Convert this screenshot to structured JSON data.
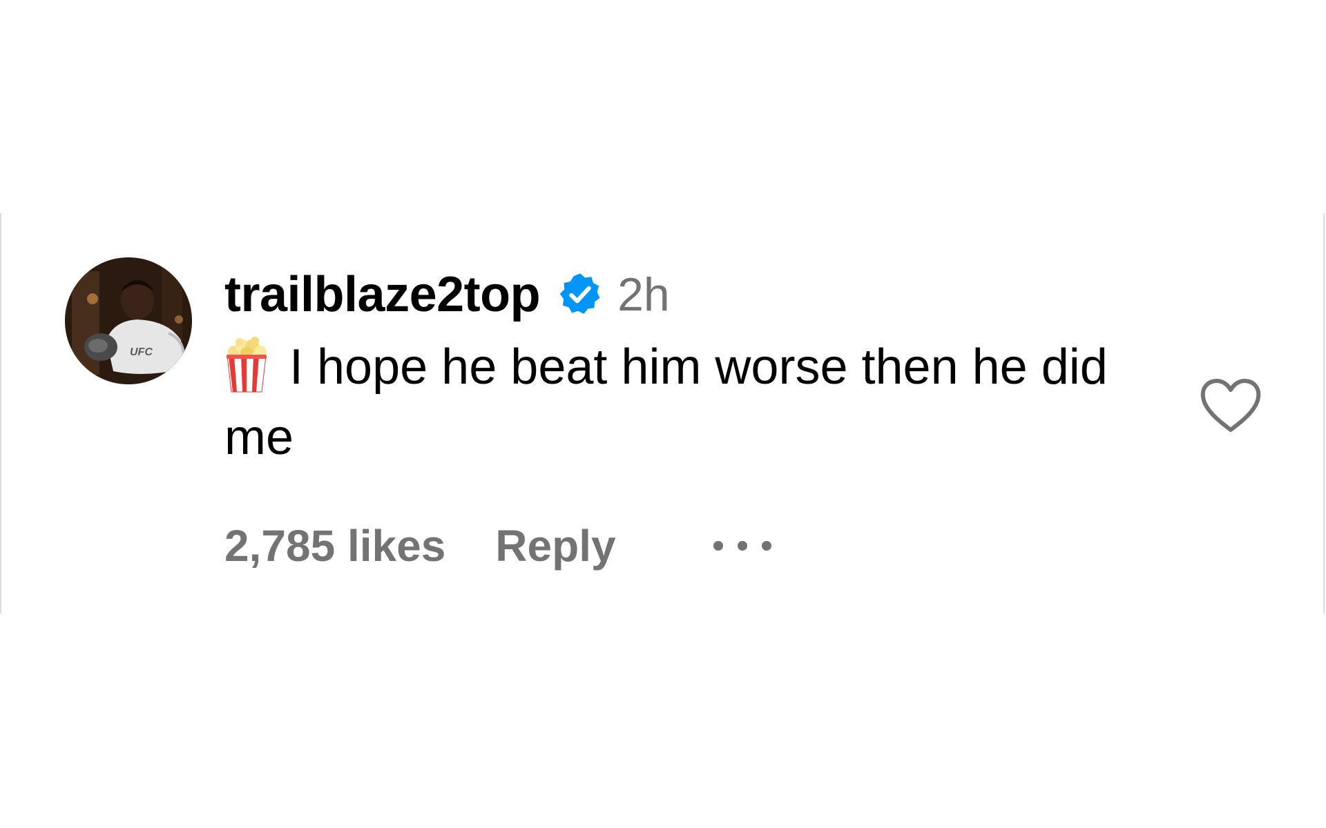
{
  "comment": {
    "username": "trailblaze2top",
    "verified": true,
    "time": "2h",
    "emoji": "popcorn",
    "text": "I hope he beat him worse then he did me",
    "likes_label": "2,785 likes",
    "reply_label": "Reply",
    "avatar_logo_text": "UFC"
  },
  "colors": {
    "verified_badge": "#0095f6",
    "secondary_text": "#737373",
    "primary_text": "#000000",
    "card_border": "#dcdcdc"
  },
  "icons": {
    "verified": "verified-badge-icon",
    "emoji": "popcorn-icon",
    "like": "heart-outline-icon",
    "more": "more-options-icon"
  }
}
